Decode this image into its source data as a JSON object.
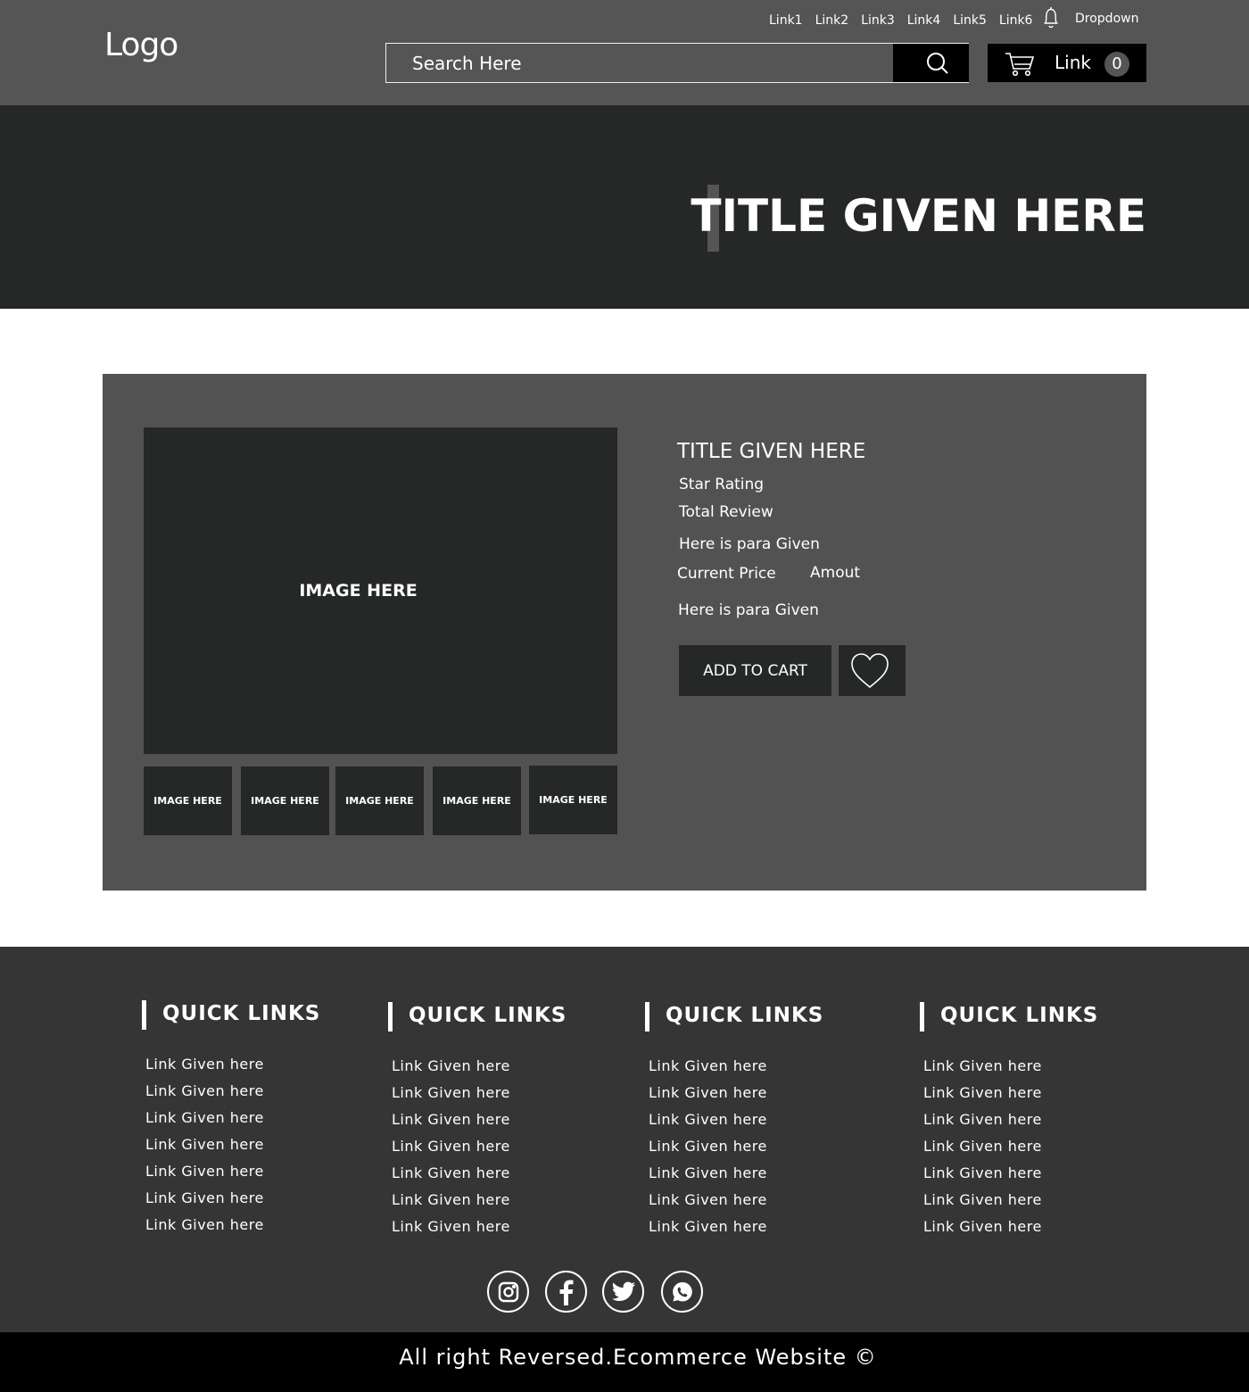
{
  "header": {
    "logo": "Logo",
    "nav_links": [
      "Link1",
      "Link2",
      "Link3",
      "Link4",
      "Link5",
      "Link6"
    ],
    "dropdown_label": "Dropdown",
    "search_placeholder": "Search Here",
    "cart_label": "Link",
    "cart_count": "0"
  },
  "hero": {
    "title": "TITLE GIVEN HERE"
  },
  "product": {
    "main_image_label": "IMAGE HERE",
    "thumbnails": [
      "IMAGE HERE",
      "IMAGE HERE",
      "IMAGE HERE",
      "IMAGE HERE",
      "IMAGE HERE"
    ],
    "title": "TITLE GIVEN HERE",
    "star_rating": "Star Rating",
    "total_review": "Total Review",
    "para1": "Here is para Given",
    "price_label": "Current Price",
    "price_amount": "Amout",
    "para2": "Here is para Given",
    "add_to_cart": "ADD TO CART"
  },
  "footer": {
    "columns": [
      {
        "heading": "QUICK LINKS",
        "links": [
          "Link Given here",
          "Link Given here",
          "Link Given here",
          "Link Given here",
          "Link Given here",
          "Link Given here",
          "Link Given here"
        ]
      },
      {
        "heading": "QUICK LINKS",
        "links": [
          "Link Given here",
          "Link Given here",
          "Link Given here",
          "Link Given here",
          "Link Given here",
          "Link Given here",
          "Link Given here"
        ]
      },
      {
        "heading": "QUICK LINKS",
        "links": [
          "Link Given here",
          "Link Given here",
          "Link Given here",
          "Link Given here",
          "Link Given here",
          "Link Given here",
          "Link Given here"
        ]
      },
      {
        "heading": "QUICK LINKS",
        "links": [
          "Link Given here",
          "Link Given here",
          "Link Given here",
          "Link Given here",
          "Link Given here",
          "Link Given here",
          "Link Given here"
        ]
      }
    ],
    "social_icons": [
      "instagram-icon",
      "facebook-icon",
      "twitter-icon",
      "whatsapp-icon"
    ],
    "copyright": "All right Reversed.Ecommerce Website ©"
  },
  "colors": {
    "header_bg": "#555555",
    "hero_bg": "#262828",
    "panel_bg": "#525252",
    "footer_bg": "#353535",
    "copyright_bg": "#000000"
  }
}
